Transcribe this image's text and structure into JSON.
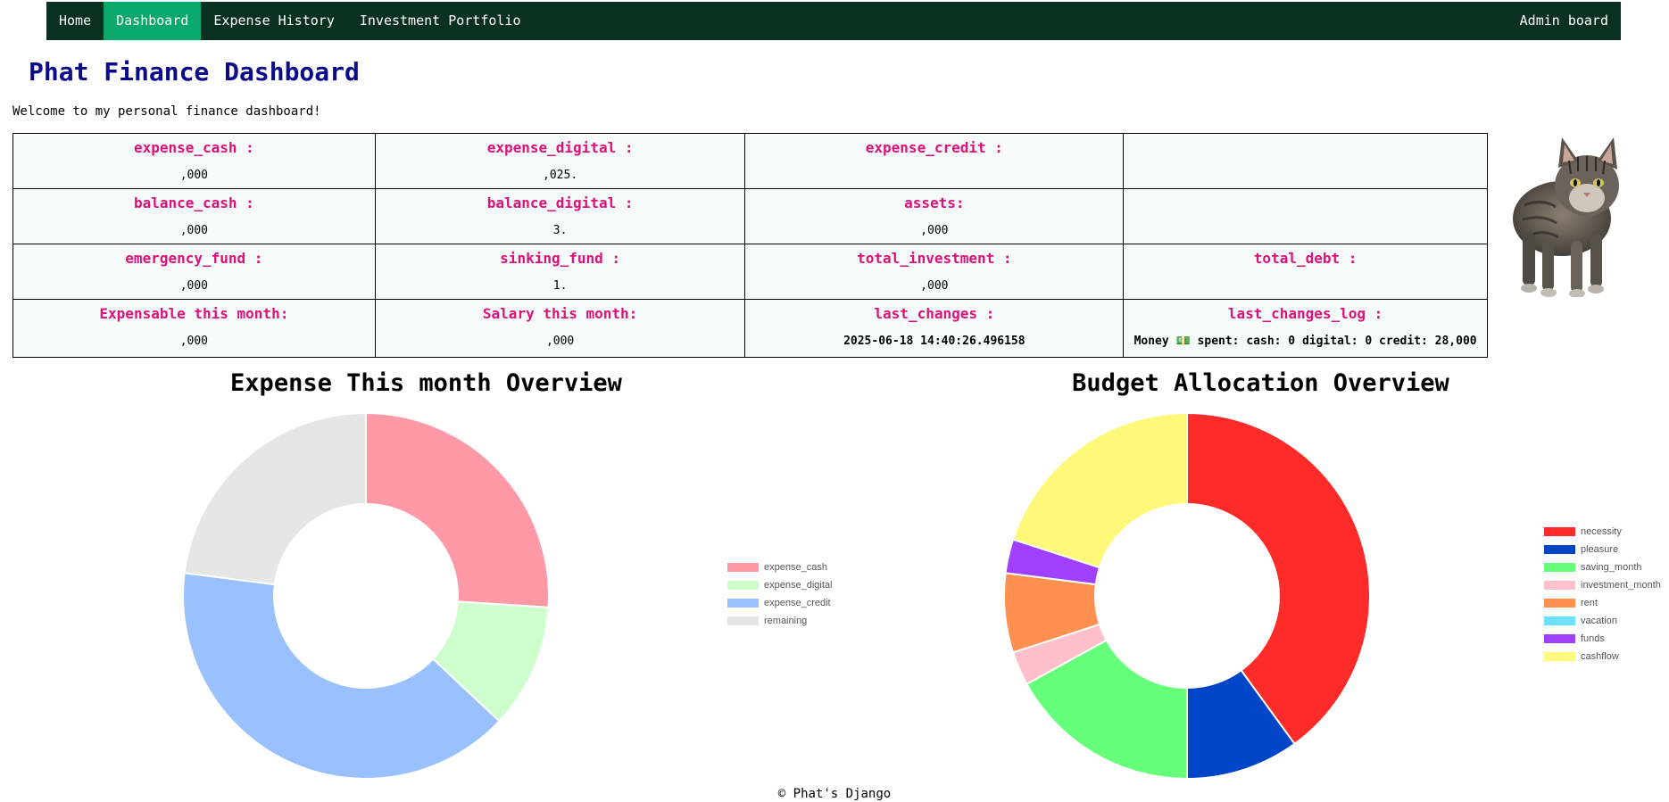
{
  "nav": {
    "items": [
      {
        "label": "Home",
        "active": false
      },
      {
        "label": "Dashboard",
        "active": true
      },
      {
        "label": "Expense History",
        "active": false
      },
      {
        "label": "Investment Portfolio",
        "active": false
      }
    ],
    "admin_label": "Admin board"
  },
  "page": {
    "title": "Phat Finance Dashboard",
    "welcome": "Welcome to my personal finance dashboard!"
  },
  "stats": {
    "rows": [
      [
        {
          "label": "expense_cash :",
          "value": ",000"
        },
        {
          "label": "expense_digital :",
          "value": ",025."
        },
        {
          "label": "expense_credit :",
          "value": ""
        },
        {
          "label": "",
          "value": ""
        }
      ],
      [
        {
          "label": "balance_cash :",
          "value": ",000"
        },
        {
          "label": "balance_digital :",
          "value": "3."
        },
        {
          "label": "assets:",
          "value": ",000"
        },
        {
          "label": "",
          "value": ""
        }
      ],
      [
        {
          "label": "emergency_fund :",
          "value": ",000"
        },
        {
          "label": "sinking_fund :",
          "value": "1."
        },
        {
          "label": "total_investment :",
          "value": ",000"
        },
        {
          "label": "total_debt :",
          "value": ""
        }
      ],
      [
        {
          "label": "Expensable this month:",
          "value": ",000"
        },
        {
          "label": "Salary this month:",
          "value": ",000"
        },
        {
          "label": "last_changes :",
          "value": "2025-06-18 14:40:26.496158"
        },
        {
          "label": "last_changes_log :",
          "value": "Money 💵 spent: cash: 0 digital: 0 credit: 28,000"
        }
      ]
    ]
  },
  "image": {
    "subject": "cat-photo"
  },
  "chart_data": [
    {
      "type": "pie",
      "variant": "doughnut",
      "title": "Expense This month Overview",
      "categories": [
        "expense_cash",
        "expense_digital",
        "expense_credit",
        "remaining"
      ],
      "values": [
        26,
        11,
        40,
        23
      ],
      "colors": [
        "#ff99a5",
        "#ccffcc",
        "#99c0ff",
        "#e6e6e6"
      ],
      "legend": "right"
    },
    {
      "type": "pie",
      "variant": "doughnut",
      "title": "Budget Allocation Overview",
      "categories": [
        "necessity",
        "pleasure",
        "saving_month",
        "investment_month",
        "rent",
        "vacation",
        "funds",
        "cashflow"
      ],
      "values": [
        40,
        10,
        17,
        3,
        7,
        0,
        3,
        20
      ],
      "colors": [
        "#ff2a2a",
        "#0044c8",
        "#66ff7a",
        "#ffc0cb",
        "#ff9050",
        "#70e0ff",
        "#a040ff",
        "#fff878"
      ],
      "legend": "right"
    }
  ],
  "footer": {
    "text": "© Phat's Django"
  }
}
